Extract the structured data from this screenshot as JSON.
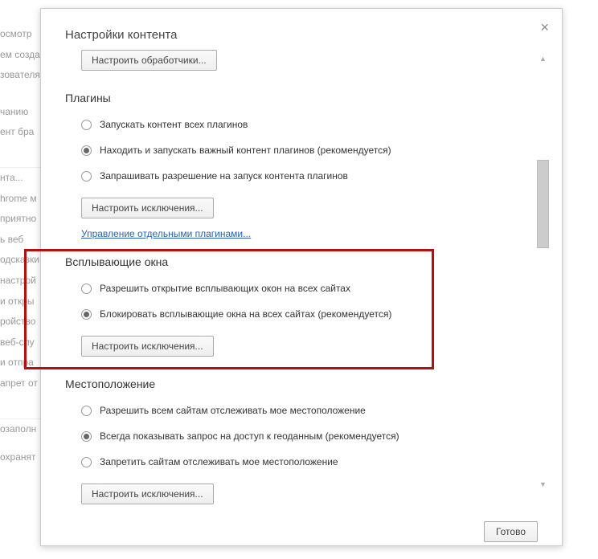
{
  "dialog": {
    "title": "Настройки контента",
    "close": "×",
    "done_button": "Готово",
    "handlers_button": "Настроить обработчики..."
  },
  "plugins": {
    "header": "Плагины",
    "options": [
      {
        "label": "Запускать контент всех плагинов"
      },
      {
        "label": "Находить и запускать важный контент плагинов (рекомендуется)"
      },
      {
        "label": "Запрашивать разрешение на запуск контента плагинов"
      }
    ],
    "exceptions_button": "Настроить исключения...",
    "manage_link": "Управление отдельными плагинами..."
  },
  "popups": {
    "header": "Всплывающие окна",
    "options": [
      {
        "label": "Разрешить открытие всплывающих окон на всех сайтах"
      },
      {
        "label": "Блокировать всплывающие окна на всех сайтах (рекомендуется)"
      }
    ],
    "exceptions_button": "Настроить исключения..."
  },
  "location": {
    "header": "Местоположение",
    "options": [
      {
        "label": "Разрешить всем сайтам отслеживать мое местоположение"
      },
      {
        "label": "Всегда показывать запрос на доступ к геоданным (рекомендуется)"
      },
      {
        "label": "Запретить сайтам отслеживать мое местоположение"
      }
    ],
    "exceptions_button": "Настроить исключения..."
  },
  "background": {
    "lines": [
      "осмотр",
      "ем созда",
      "зователя",
      "",
      "чанию",
      "ент бра",
      "",
      "",
      "нта...",
      "hrome м",
      "приятно",
      "ь веб",
      "одсказки",
      "настрой",
      "и откры",
      "ройство",
      "веб-слу",
      "и отпра",
      "апрет от",
      "",
      "",
      "озаполн",
      "",
      "охранят"
    ]
  }
}
